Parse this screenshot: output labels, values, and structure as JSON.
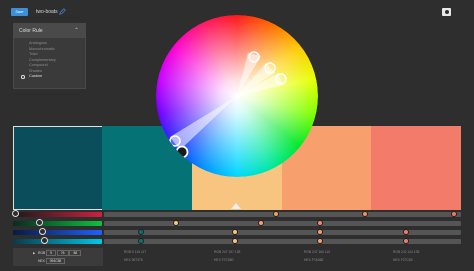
{
  "header": {
    "save_label": "Save",
    "theme_name": "two-boats"
  },
  "color_rule": {
    "title": "Color Rule",
    "options": [
      "Analogous",
      "Monochromatic",
      "Triad",
      "Complementary",
      "Compound",
      "Shades",
      "Custom"
    ],
    "selected": "Custom"
  },
  "palette": {
    "swatches": [
      {
        "color": "#0a4d5b",
        "active": true
      },
      {
        "color": "#057375"
      },
      {
        "color": "#f7c580"
      },
      {
        "color": "#f7a06e"
      },
      {
        "color": "#f27c69"
      }
    ]
  },
  "sliders": {
    "rows": [
      {
        "gradient": "linear-gradient(90deg,#1a1a1a,#d02040)"
      },
      {
        "gradient": "linear-gradient(90deg,#0a2a20,#10c040)"
      },
      {
        "gradient": "linear-gradient(90deg,#0a1a40,#2060ff)"
      },
      {
        "gradient": "linear-gradient(90deg,#0a3a4a,#00c8e8)"
      }
    ]
  },
  "values": {
    "active": {
      "rgb_label": "RGB",
      "rgb": [
        "9",
        "76",
        "88"
      ],
      "hex_label": "HEX",
      "hex": "094C58"
    },
    "cells": [
      {
        "rgb": "RGB  5  115  117",
        "hex": "HEX  057375"
      },
      {
        "rgb": "RGB  247  197  128",
        "hex": "HEX  F7C580"
      },
      {
        "rgb": "RGB  247  160  110",
        "hex": "HEX  F7A06E"
      },
      {
        "rgb": "RGB  242  124  105",
        "hex": "HEX  F27C69"
      }
    ]
  },
  "icons": [
    "pencil-icon",
    "camera-icon",
    "chevron-up-icon",
    "radio-icon",
    "triangle-icon"
  ]
}
